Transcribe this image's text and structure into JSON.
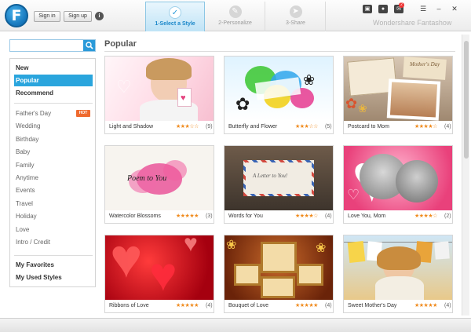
{
  "app": {
    "logo_letter": "F",
    "brand": "Wondershare Fantashow",
    "signin": "Sign in",
    "signup": "Sign up",
    "info": "i"
  },
  "steps": [
    {
      "label": "1-Select a Style",
      "active": true
    },
    {
      "label": "2-Personalize",
      "active": false
    },
    {
      "label": "3-Share",
      "active": false
    }
  ],
  "top_icons": {
    "notification_count": "2"
  },
  "search": {
    "placeholder": "",
    "value": ""
  },
  "sidebar": {
    "primary": [
      "New",
      "Popular",
      "Recommend"
    ],
    "active": "Popular",
    "categories": [
      "Father's Day",
      "Wedding",
      "Birthday",
      "Baby",
      "Family",
      "Anytime",
      "Events",
      "Travel",
      "Holiday",
      "Love",
      "Intro / Credit"
    ],
    "hot_label": "HOT",
    "extras": [
      "My Favorites",
      "My Used Styles"
    ]
  },
  "main": {
    "section_title": "Popular"
  },
  "cards": [
    {
      "title": "Light and Shadow",
      "stars": "★★★☆☆",
      "count": "(9)"
    },
    {
      "title": "Butterfly and Flower",
      "stars": "★★★☆☆",
      "count": "(5)"
    },
    {
      "title": "Postcard to Mom",
      "stars": "★★★★☆",
      "count": "(4)"
    },
    {
      "title": "Watercolor Blossoms",
      "stars": "★★★★★",
      "count": "(3)"
    },
    {
      "title": "Words for You",
      "stars": "★★★★☆",
      "count": "(4)"
    },
    {
      "title": "Love You, Mom",
      "stars": "★★★★☆",
      "count": "(2)"
    },
    {
      "title": "Ribbons of Love",
      "stars": "★★★★★",
      "count": "(4)"
    },
    {
      "title": "Bouquet of Love",
      "stars": "★★★★★",
      "count": "(4)"
    },
    {
      "title": "Sweet Mother's Day",
      "stars": "★★★★★",
      "count": "(4)"
    }
  ],
  "thumb_text": {
    "poem": "Poem to You",
    "letter": "A Letter to You!",
    "postcard_script": "Mother's Day"
  },
  "colors": {
    "accent": "#2aa5dd",
    "hot": "#ef6a2e",
    "stars": "#f08a1c"
  }
}
